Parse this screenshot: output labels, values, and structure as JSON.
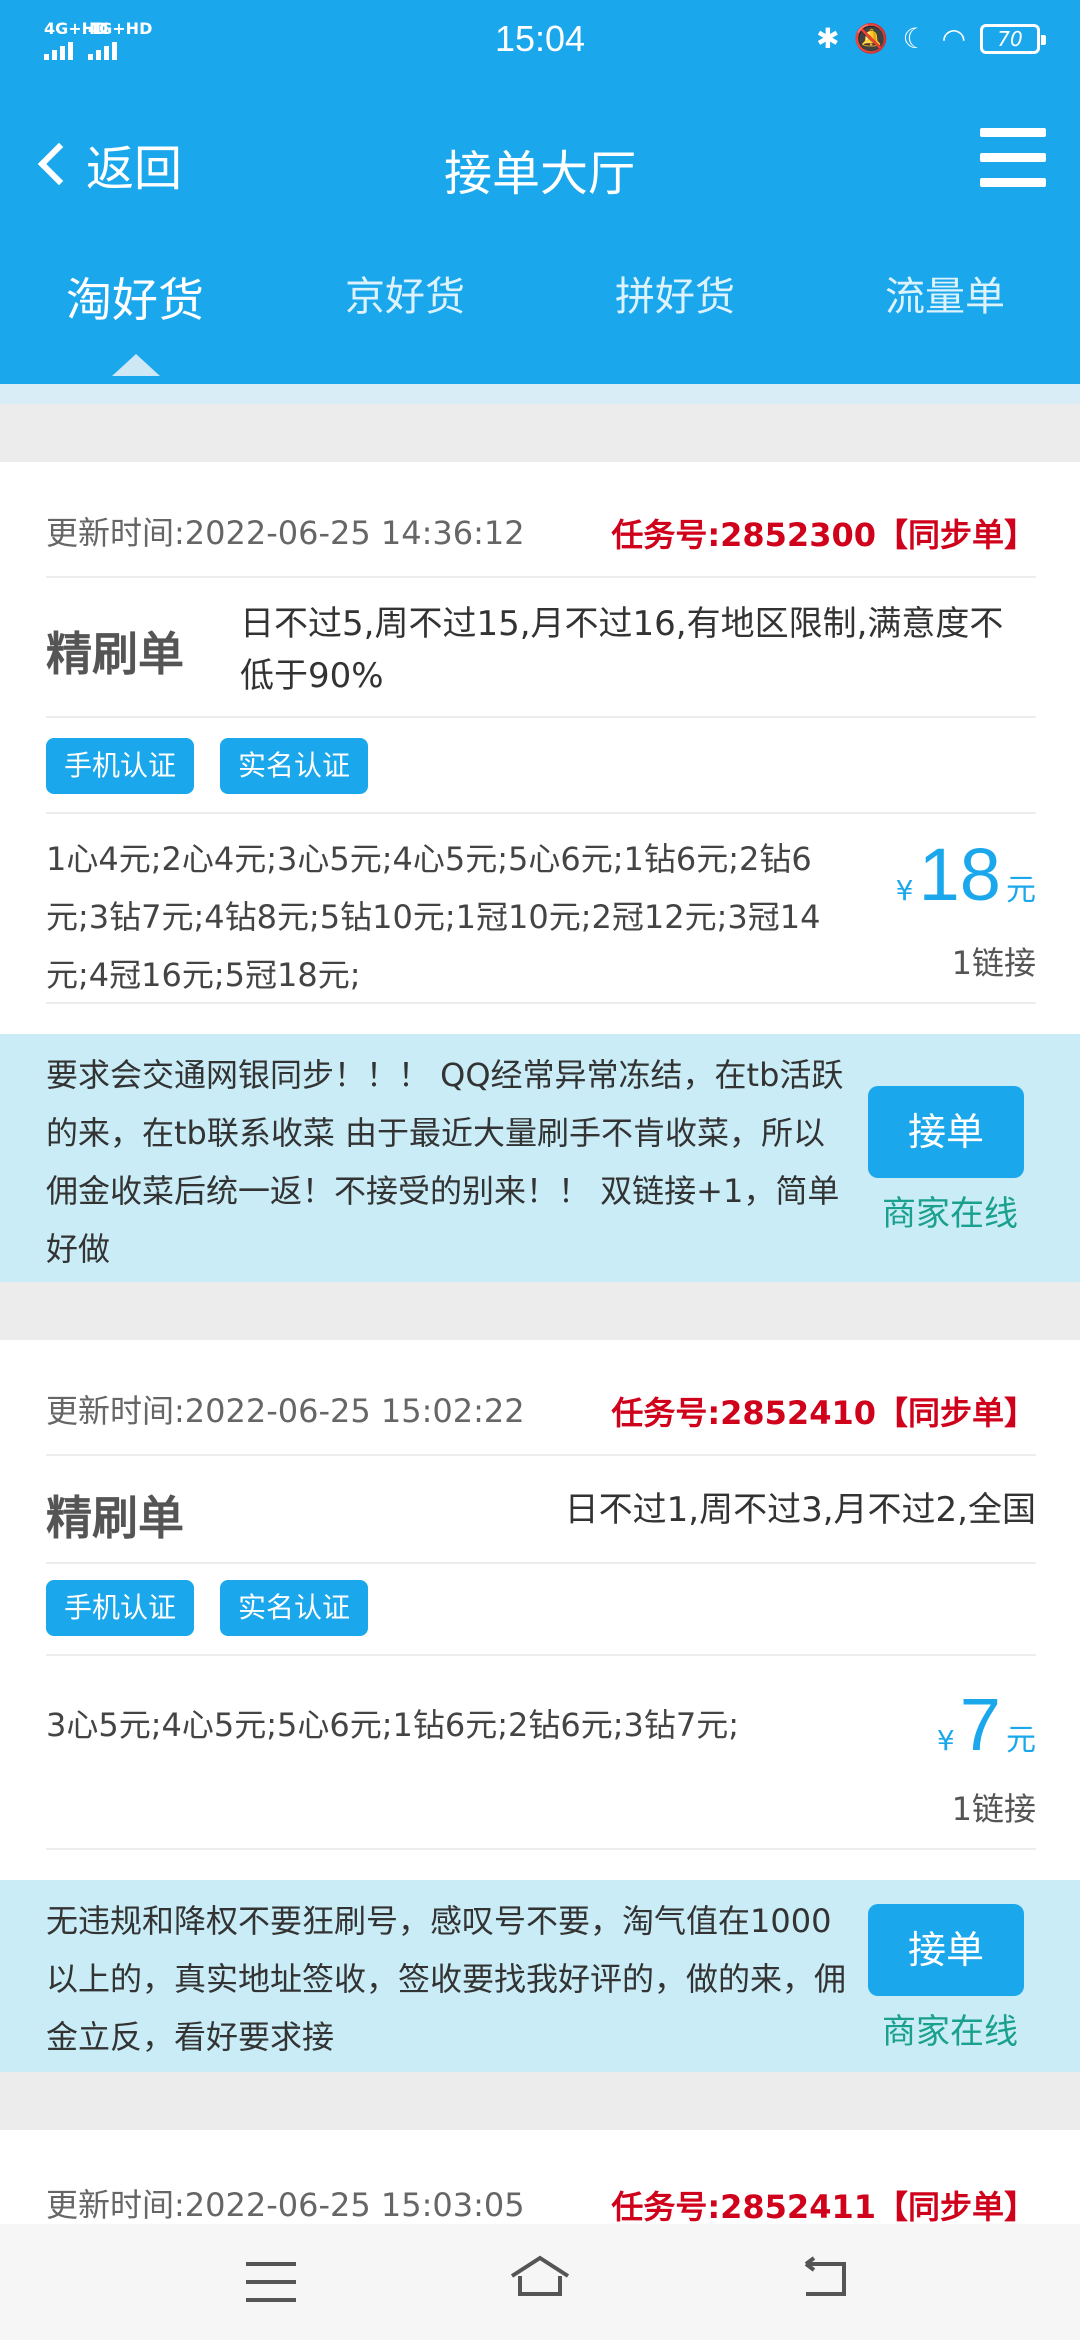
{
  "status": {
    "network1": "4G+HD",
    "network2": "4G+HD",
    "time": "15:04",
    "battery": "70"
  },
  "header": {
    "back_label": "返回",
    "title": "接单大厅",
    "tabs": [
      "淘好货",
      "京好货",
      "拼好货",
      "流量单"
    ]
  },
  "tasks": [
    {
      "updated": "更新时间:2022-06-25 14:36:12",
      "task_no": "任务号:2852300【同步单】",
      "type": "精刷单",
      "limits": "日不过5,周不过15,月不过16,有地区限制,满意度不低于90%",
      "badges": [
        "手机认证",
        "实名认证"
      ],
      "prices_text": "1心4元;2心4元;3心5元;4心5元;5心6元;1钻6元;2钻6元;3钻7元;4钻8元;5钻10元;1冠10元;2冠12元;3冠14元;4冠16元;5冠18元;",
      "price_symbol": "¥",
      "price": "18",
      "price_unit": "元",
      "links": "1链接",
      "note": "要求会交通网银同步！！！ QQ经常异常冻结，在tb活跃的来，在tb联系收菜 由于最近大量刷手不肯收菜，所以佣金收菜后统一返！不接受的别来！！ 双链接+1，简单好做",
      "accept_label": "接单",
      "merchant_status": "商家在线"
    },
    {
      "updated": "更新时间:2022-06-25 15:02:22",
      "task_no": "任务号:2852410【同步单】",
      "type": "精刷单",
      "limits": "日不过1,周不过3,月不过2,全国",
      "badges": [
        "手机认证",
        "实名认证"
      ],
      "prices_text": "3心5元;4心5元;5心6元;1钻6元;2钻6元;3钻7元;",
      "price_symbol": "¥",
      "price": "7",
      "price_unit": "元",
      "links": "1链接",
      "note": "无违规和降权不要狂刷号，感叹号不要，淘气值在1000以上的，真实地址签收，签收要找我好评的，做的来，佣金立反，看好要求接",
      "accept_label": "接单",
      "merchant_status": "商家在线"
    },
    {
      "updated": "更新时间:2022-06-25 15:03:05",
      "task_no": "任务号:2852411【同步单】"
    }
  ]
}
